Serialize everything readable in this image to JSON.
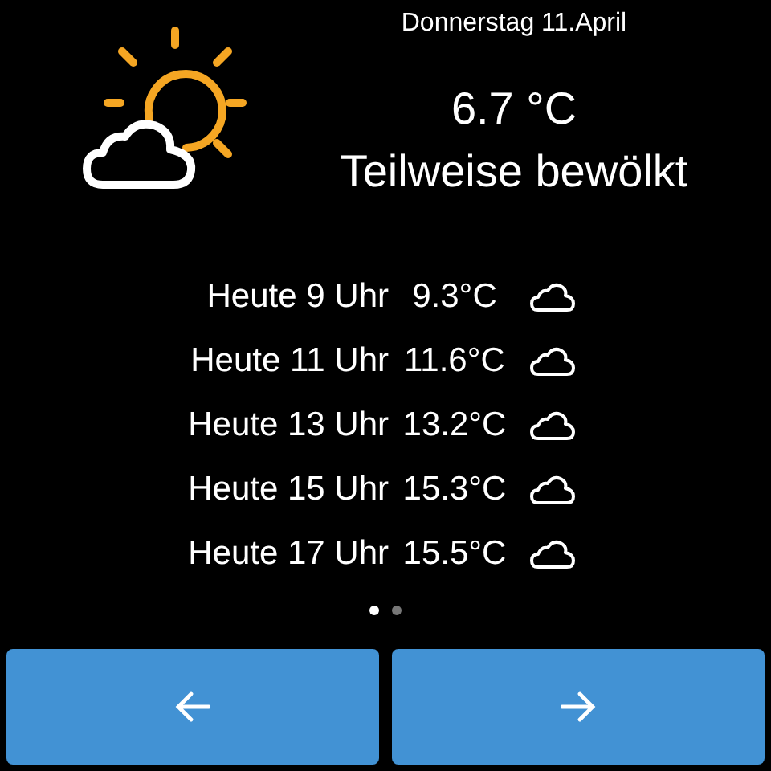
{
  "header": {
    "date": "Donnerstag 11.April",
    "temperature": "6.7 °C",
    "condition": "Teilweise bewölkt"
  },
  "forecast": [
    {
      "time": "Heute 9 Uhr",
      "temperature": "9.3°C"
    },
    {
      "time": "Heute 11 Uhr",
      "temperature": "11.6°C"
    },
    {
      "time": "Heute 13 Uhr",
      "temperature": "13.2°C"
    },
    {
      "time": "Heute 15 Uhr",
      "temperature": "15.3°C"
    },
    {
      "time": "Heute 17 Uhr",
      "temperature": "15.5°C"
    }
  ],
  "pages": [
    {
      "selected": true
    },
    {
      "selected": false
    }
  ]
}
